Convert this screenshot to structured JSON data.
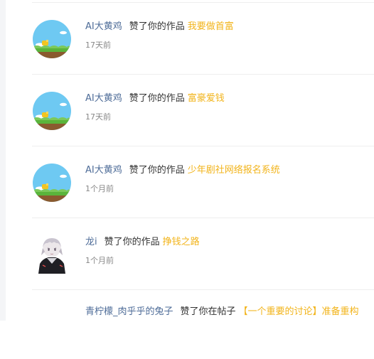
{
  "notifications": [
    {
      "user": "AI大黄鸡",
      "action": "赞了你的作品",
      "target": "我要做首富",
      "time": "17天前",
      "avatar": "game-scene-avatar"
    },
    {
      "user": "AI大黄鸡",
      "action": "赞了你的作品",
      "target": "富豪爱钱",
      "time": "17天前",
      "avatar": "game-scene-avatar"
    },
    {
      "user": "AI大黄鸡",
      "action": "赞了你的作品",
      "target": "少年剧社网络报名系统",
      "time": "1个月前",
      "avatar": "game-scene-avatar"
    },
    {
      "user": "龙i",
      "action": "赞了你的作品",
      "target": "挣钱之路",
      "time": "1个月前",
      "avatar": "anime-character-avatar"
    },
    {
      "user": "青柠檬_肉乎乎的兔子",
      "action": "赞了你在帖子",
      "target": "【一个重要的讨论】准备重构",
      "time": "",
      "avatar": ""
    }
  ]
}
